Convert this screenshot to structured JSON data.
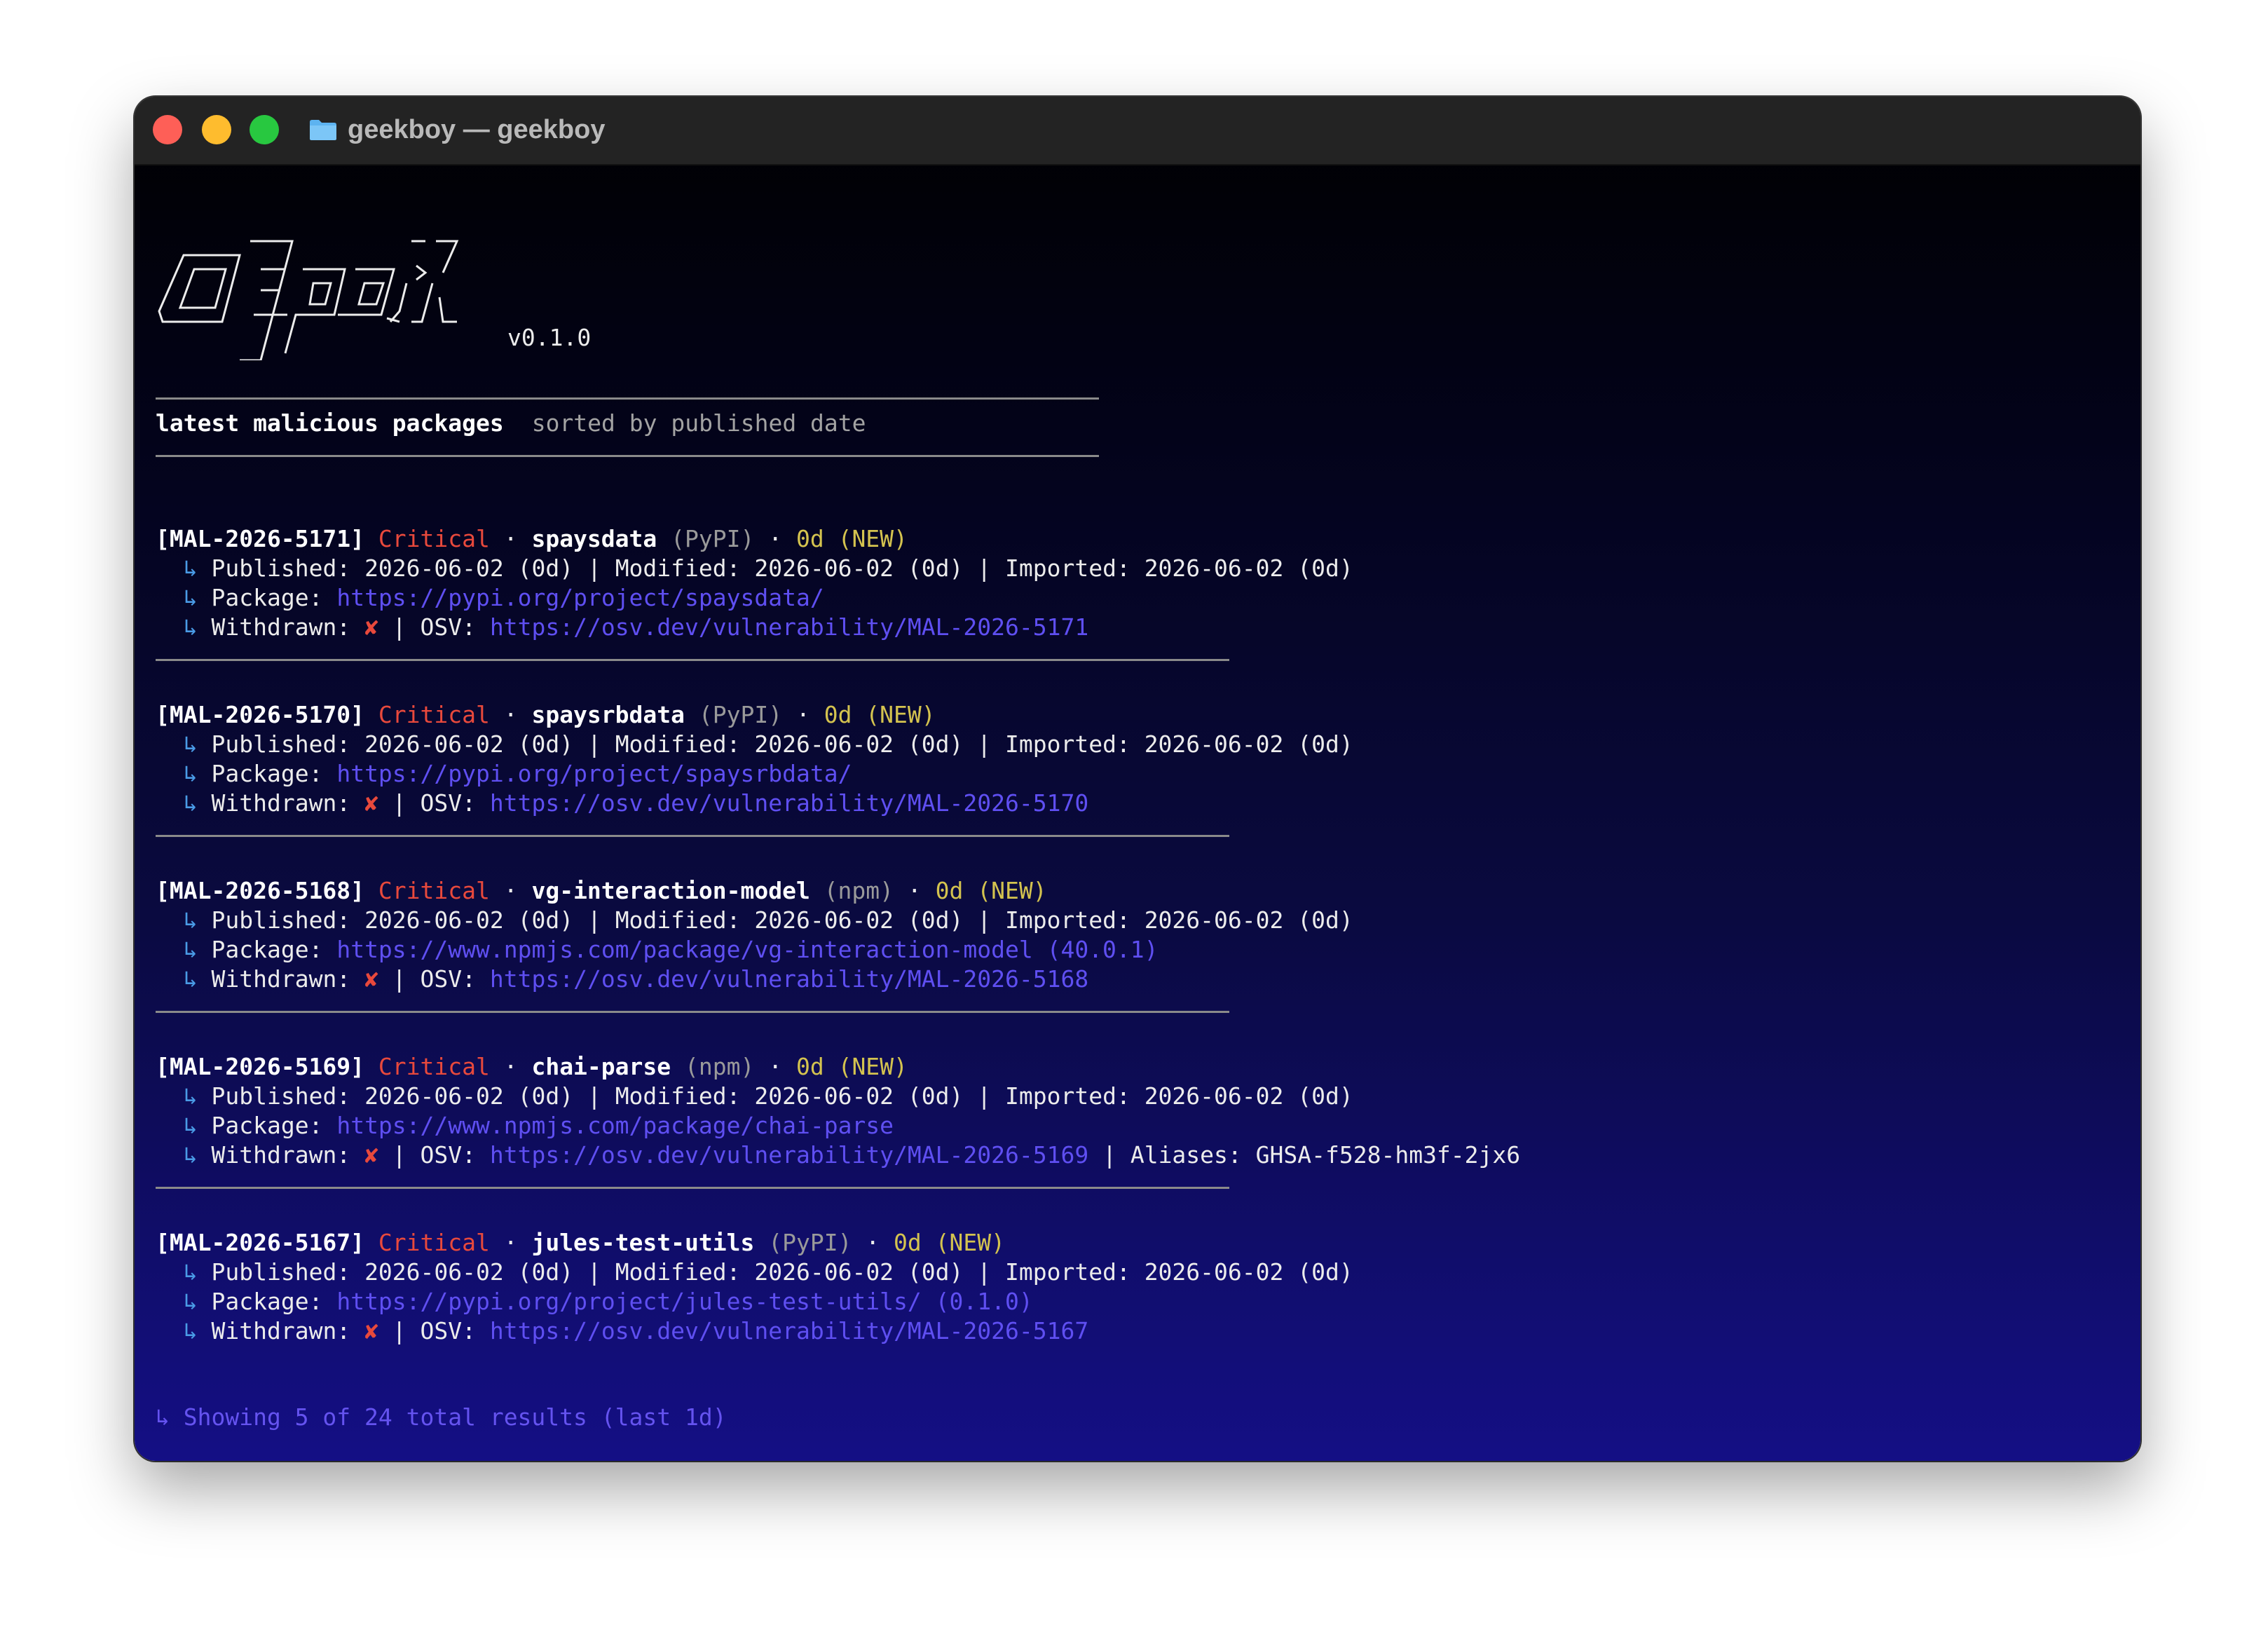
{
  "window": {
    "title": "geekboy — geekboy"
  },
  "banner": {
    "version": "v0.1.0"
  },
  "section": {
    "title": "latest malicious packages",
    "subtitle": "sorted by published date"
  },
  "labels": {
    "published": "Published:",
    "modified": "Modified:",
    "imported": "Imported:",
    "package": "Package:",
    "withdrawn": "Withdrawn:",
    "osv": "OSV:",
    "aliases": "Aliases:",
    "separator": " | ",
    "dot": " · ",
    "arrow": "↳",
    "withdrawn_mark": "✘"
  },
  "entries": [
    {
      "id": "[MAL-2026-5171]",
      "severity": "Critical",
      "name": "spaysdata",
      "ecosystem": "(PyPI)",
      "age": "0d (NEW)",
      "published": "2026-06-02 (0d)",
      "modified": "2026-06-02 (0d)",
      "imported": "2026-06-02 (0d)",
      "package_url": "https://pypi.org/project/spaysdata/",
      "osv_url": "https://osv.dev/vulnerability/MAL-2026-5171",
      "aliases": ""
    },
    {
      "id": "[MAL-2026-5170]",
      "severity": "Critical",
      "name": "spaysrbdata",
      "ecosystem": "(PyPI)",
      "age": "0d (NEW)",
      "published": "2026-06-02 (0d)",
      "modified": "2026-06-02 (0d)",
      "imported": "2026-06-02 (0d)",
      "package_url": "https://pypi.org/project/spaysrbdata/",
      "osv_url": "https://osv.dev/vulnerability/MAL-2026-5170",
      "aliases": ""
    },
    {
      "id": "[MAL-2026-5168]",
      "severity": "Critical",
      "name": "vg-interaction-model",
      "ecosystem": "(npm)",
      "age": "0d (NEW)",
      "published": "2026-06-02 (0d)",
      "modified": "2026-06-02 (0d)",
      "imported": "2026-06-02 (0d)",
      "package_url": "https://www.npmjs.com/package/vg-interaction-model (40.0.1)",
      "osv_url": "https://osv.dev/vulnerability/MAL-2026-5168",
      "aliases": ""
    },
    {
      "id": "[MAL-2026-5169]",
      "severity": "Critical",
      "name": "chai-parse",
      "ecosystem": "(npm)",
      "age": "0d (NEW)",
      "published": "2026-06-02 (0d)",
      "modified": "2026-06-02 (0d)",
      "imported": "2026-06-02 (0d)",
      "package_url": "https://www.npmjs.com/package/chai-parse",
      "osv_url": "https://osv.dev/vulnerability/MAL-2026-5169",
      "aliases": "GHSA-f528-hm3f-2jx6"
    },
    {
      "id": "[MAL-2026-5167]",
      "severity": "Critical",
      "name": "jules-test-utils",
      "ecosystem": "(PyPI)",
      "age": "0d (NEW)",
      "published": "2026-06-02 (0d)",
      "modified": "2026-06-02 (0d)",
      "imported": "2026-06-02 (0d)",
      "package_url": "https://pypi.org/project/jules-test-utils/ (0.1.0)",
      "osv_url": "https://osv.dev/vulnerability/MAL-2026-5167",
      "aliases": ""
    }
  ],
  "footer": {
    "text": "↳ Showing 5 of 24 total results (last 1d)"
  },
  "colors": {
    "critical": "#e8493c",
    "new_badge": "#d4c34f",
    "link": "#5f4ff2",
    "arrow": "#4a9be6",
    "footer": "#6553f0"
  }
}
